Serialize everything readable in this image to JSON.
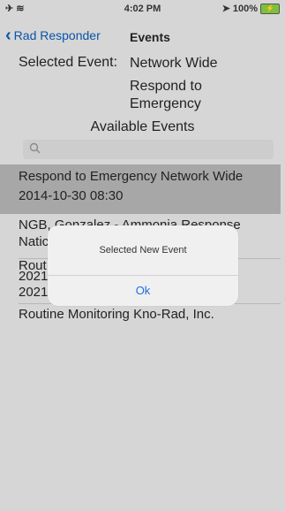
{
  "status": {
    "left_icons": "✈ ≋",
    "time": "4:02 PM",
    "location_icon": "location-arrow-icon",
    "battery_text": "100%",
    "battery_icon": "battery-charging-icon"
  },
  "nav": {
    "back_label": "Rad Responder",
    "title": "Events"
  },
  "selected": {
    "label": "Selected Event:",
    "line1": "Network Wide",
    "line2": "Respond to Emergency"
  },
  "available_title": "Available Events",
  "search": {
    "placeholder": ""
  },
  "events": [
    {
      "line1": "Respond to Emergency Network Wide",
      "line2": "2014-10-30 08:30"
    },
    {
      "line1": "NGB, Gonzalez - Ammonia Response",
      "line2": "Natic"
    },
    {
      "line1": "Rout",
      "line2": "2021"
    },
    {
      "line1": "Routine Monitoring Kno-Rad, Inc.",
      "line2": ""
    }
  ],
  "overlap_text": {
    "row3_line1b": "2021",
    "row3_line2": "2021"
  },
  "alert": {
    "title": "Selected New Event",
    "ok_label": "Ok"
  },
  "colors": {
    "accent": "#1e6fd9",
    "highlight_row": "#a7a7a7",
    "dim_background": "#d6d6d6"
  }
}
